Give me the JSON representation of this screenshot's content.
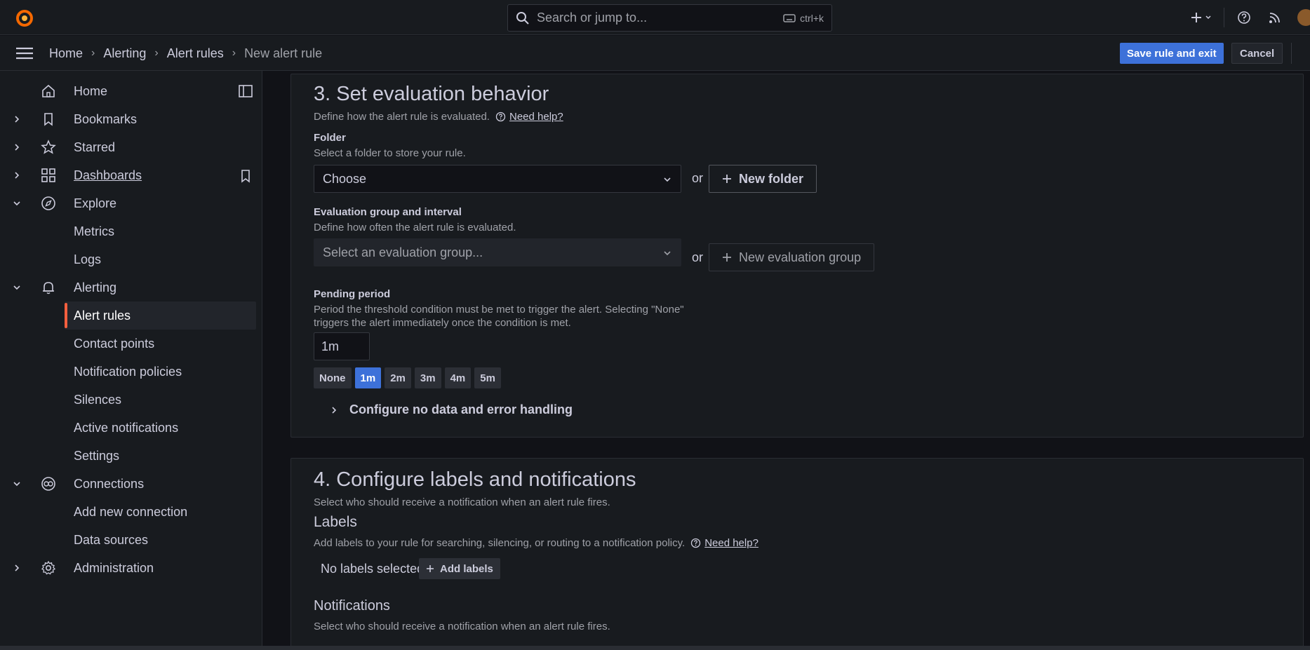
{
  "topbar": {
    "search_placeholder": "Search or jump to...",
    "search_shortcut": "ctrl+k"
  },
  "breadcrumbs": [
    "Home",
    "Alerting",
    "Alert rules",
    "New alert rule"
  ],
  "actions": {
    "save_label": "Save rule and exit",
    "cancel_label": "Cancel"
  },
  "sidebar": {
    "items": [
      {
        "label": "Home"
      },
      {
        "label": "Bookmarks"
      },
      {
        "label": "Starred"
      },
      {
        "label": "Dashboards"
      },
      {
        "label": "Explore"
      },
      {
        "label": "Metrics"
      },
      {
        "label": "Logs"
      },
      {
        "label": "Alerting"
      },
      {
        "label": "Alert rules"
      },
      {
        "label": "Contact points"
      },
      {
        "label": "Notification policies"
      },
      {
        "label": "Silences"
      },
      {
        "label": "Active notifications"
      },
      {
        "label": "Settings"
      },
      {
        "label": "Connections"
      },
      {
        "label": "Add new connection"
      },
      {
        "label": "Data sources"
      },
      {
        "label": "Administration"
      }
    ]
  },
  "section3": {
    "title": "3. Set evaluation behavior",
    "description": "Define how the alert rule is evaluated.",
    "help_label": "Need help?",
    "folder": {
      "label": "Folder",
      "description": "Select a folder to store your rule.",
      "placeholder": "Choose",
      "or": "or",
      "new_label": "New folder"
    },
    "group": {
      "label": "Evaluation group and interval",
      "description": "Define how often the alert rule is evaluated.",
      "placeholder": "Select an evaluation group...",
      "or": "or",
      "new_label": "New evaluation group"
    },
    "pending": {
      "label": "Pending period",
      "description_line1": "Period the threshold condition must be met to trigger the alert. Selecting \"None\"",
      "description_line2": "triggers the alert immediately once the condition is met.",
      "value": "1m",
      "options": [
        "None",
        "1m",
        "2m",
        "3m",
        "4m",
        "5m"
      ],
      "selected": "1m"
    },
    "collapse_label": "Configure no data and error handling"
  },
  "section4": {
    "title": "4. Configure labels and notifications",
    "description": "Select who should receive a notification when an alert rule fires.",
    "labels_title": "Labels",
    "labels_description": "Add labels to your rule for searching, silencing, or routing to a notification policy.",
    "help_label": "Need help?",
    "no_labels": "No labels selected",
    "add_labels": "Add labels",
    "notifications_title": "Notifications",
    "notifications_description": "Select who should receive a notification when an alert rule fires."
  },
  "colors": {
    "accent": "#3d71d9",
    "active_marker": "#f55f3e",
    "bg": "#111217",
    "panel": "#181b1f"
  }
}
